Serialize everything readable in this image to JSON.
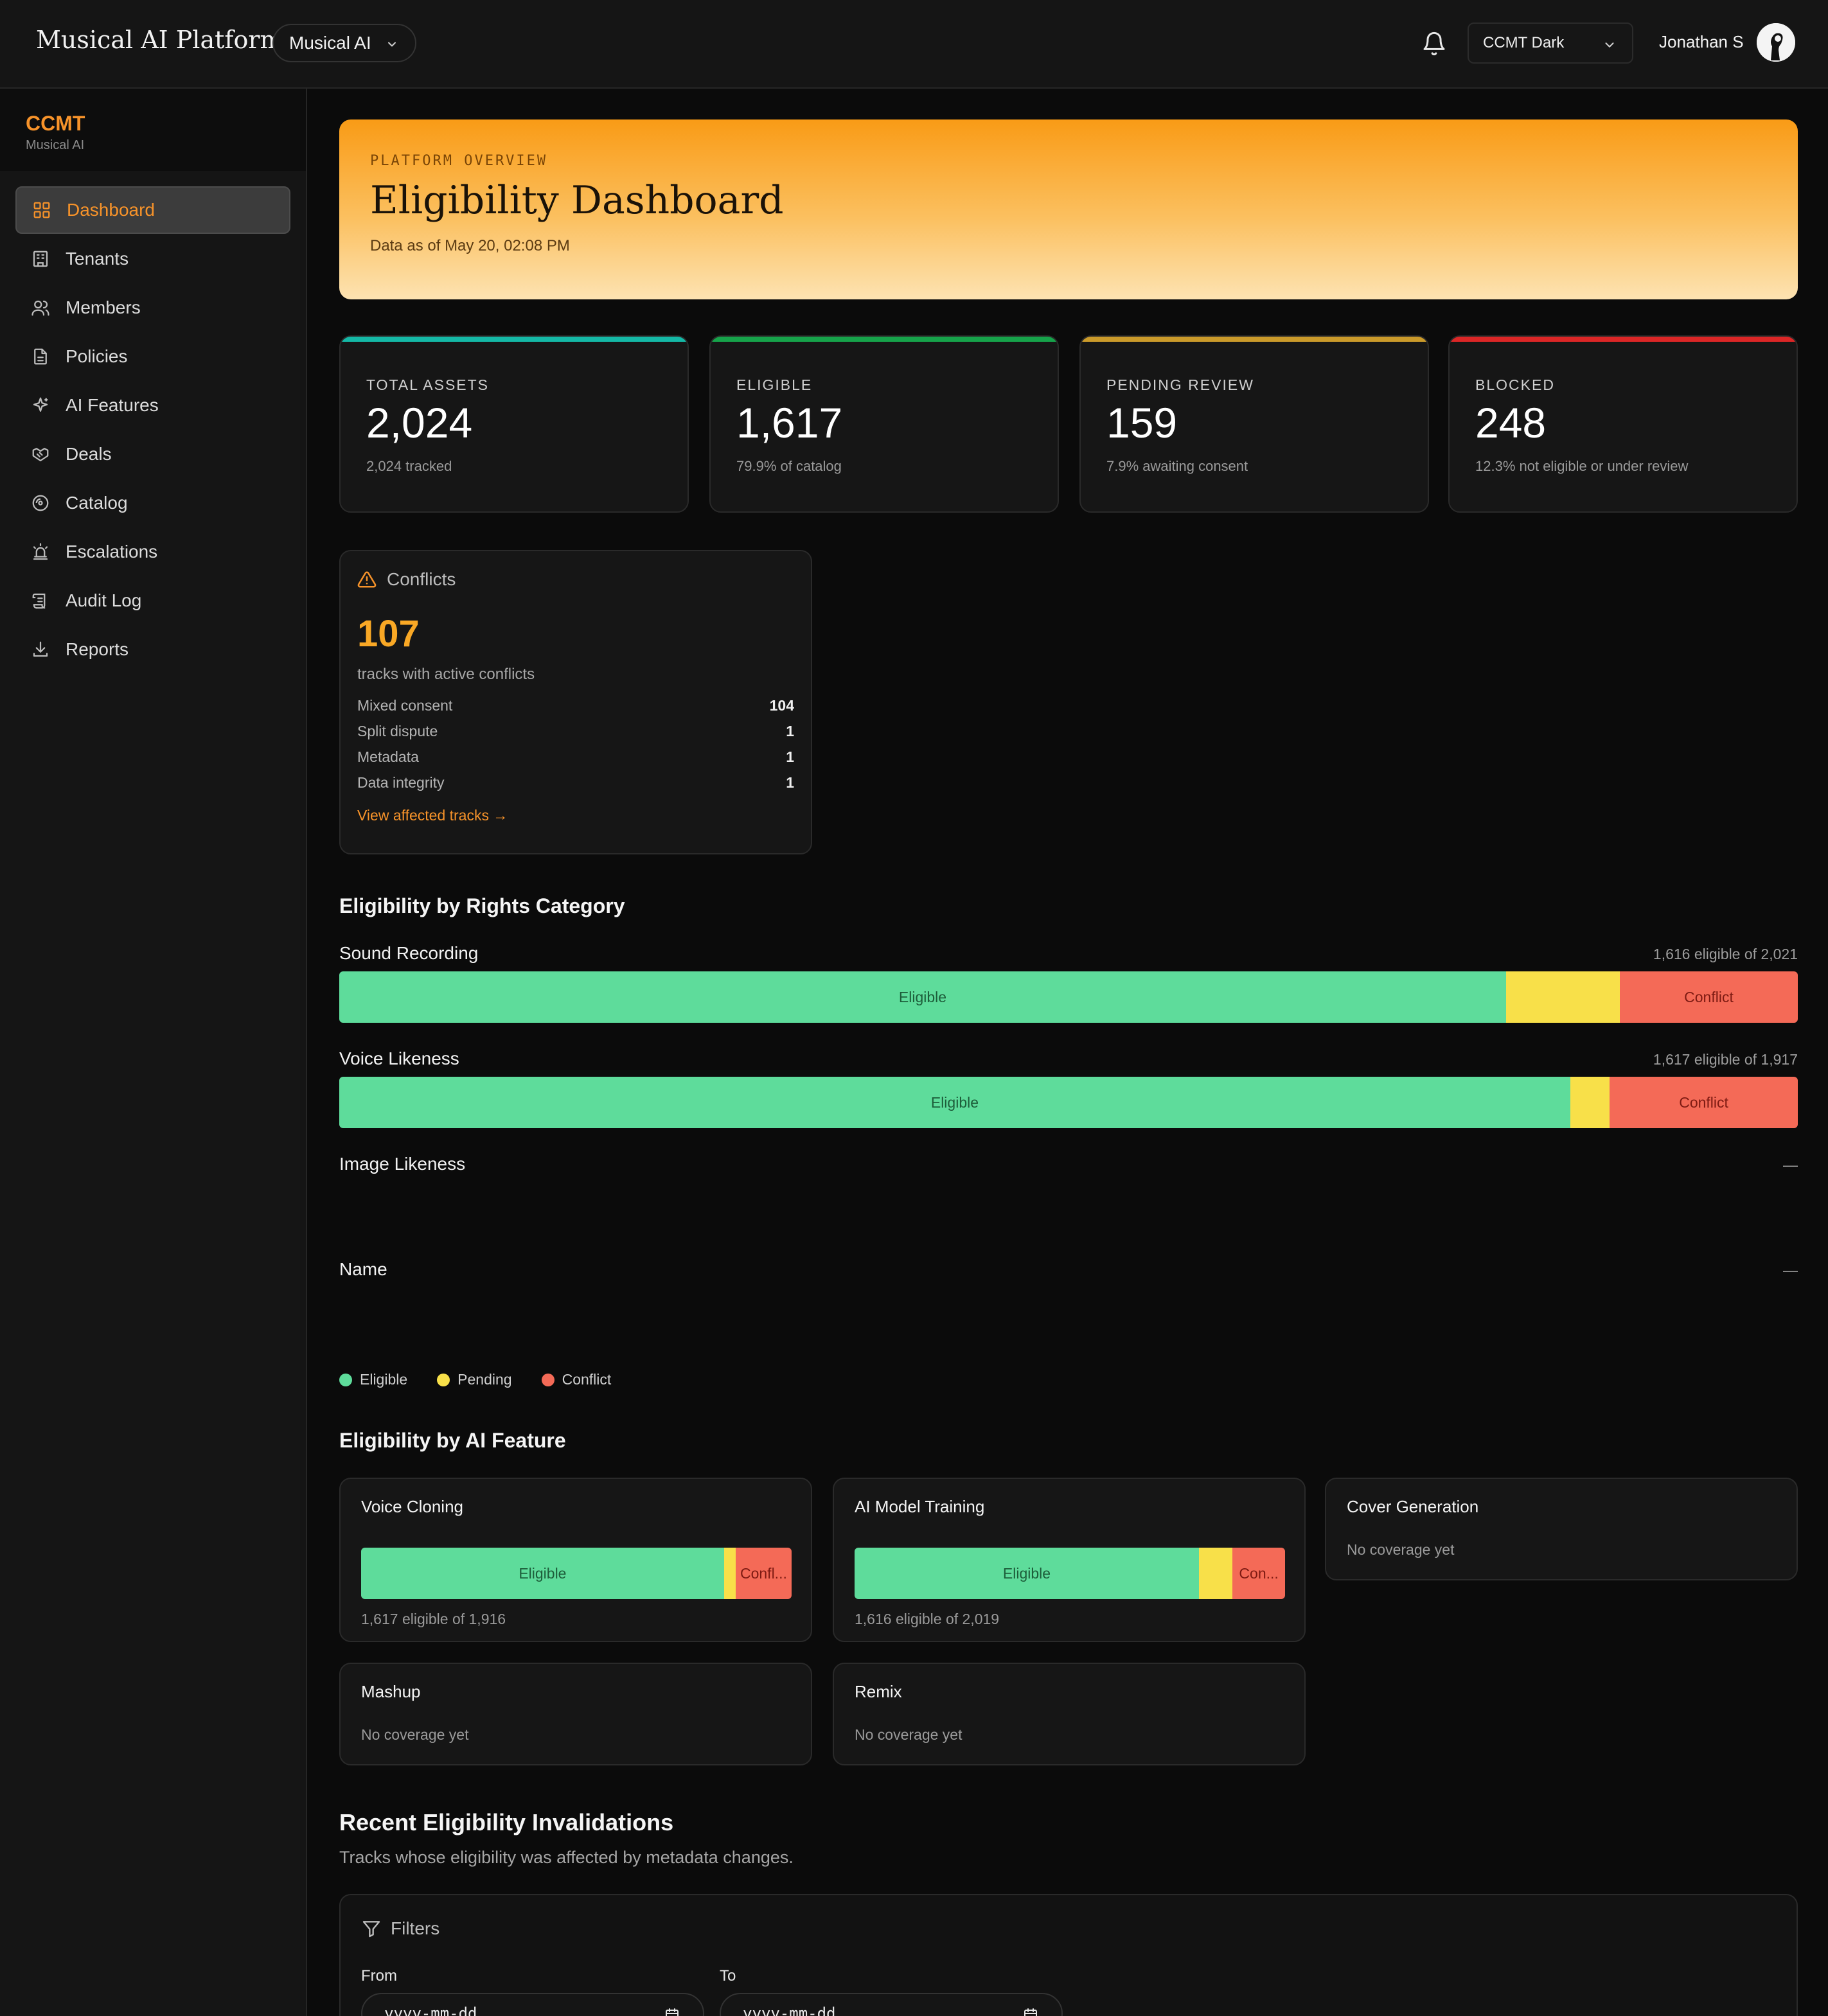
{
  "header": {
    "brand": "Musical AI Platform",
    "org_select": "Musical AI",
    "theme_select": "CCMT Dark",
    "user_name": "Jonathan S"
  },
  "sidebar": {
    "title": "CCMT",
    "subtitle": "Musical AI",
    "items": [
      {
        "label": "Dashboard",
        "icon": "grid-icon",
        "active": true
      },
      {
        "label": "Tenants",
        "icon": "building-icon"
      },
      {
        "label": "Members",
        "icon": "users-icon"
      },
      {
        "label": "Policies",
        "icon": "file-text-icon"
      },
      {
        "label": "AI Features",
        "icon": "sparkles-icon"
      },
      {
        "label": "Deals",
        "icon": "handshake-icon"
      },
      {
        "label": "Catalog",
        "icon": "disc-icon"
      },
      {
        "label": "Escalations",
        "icon": "siren-icon"
      },
      {
        "label": "Audit Log",
        "icon": "scroll-icon"
      },
      {
        "label": "Reports",
        "icon": "download-icon"
      }
    ]
  },
  "hero": {
    "eyebrow": "PLATFORM OVERVIEW",
    "title": "Eligibility Dashboard",
    "subtitle": "Data as of May 20, 02:08 PM"
  },
  "stats": [
    {
      "label": "TOTAL ASSETS",
      "value": "2,024",
      "sub": "2,024 tracked",
      "color": "#14b8a6"
    },
    {
      "label": "ELIGIBLE",
      "value": "1,617",
      "sub": "79.9% of catalog",
      "color": "#16a34a"
    },
    {
      "label": "PENDING REVIEW",
      "value": "159",
      "sub": "7.9% awaiting consent",
      "color": "#ca9a2a"
    },
    {
      "label": "BLOCKED",
      "value": "248",
      "sub": "12.3% not eligible or under review",
      "color": "#dc2626"
    }
  ],
  "conflicts": {
    "title": "Conflicts",
    "count": "107",
    "subtitle": "tracks with active conflicts",
    "rows": [
      {
        "label": "Mixed consent",
        "value": "104"
      },
      {
        "label": "Split dispute",
        "value": "1"
      },
      {
        "label": "Metadata",
        "value": "1"
      },
      {
        "label": "Data integrity",
        "value": "1"
      }
    ],
    "link": "View affected tracks →"
  },
  "rights": {
    "title": "Eligibility by Rights Category",
    "categories": [
      {
        "name": "Sound Recording",
        "count": "1,616 eligible of 2,021",
        "eligible": 0.8,
        "pending": 0.078,
        "conflict": 0.122,
        "eligible_label": "Eligible",
        "conflict_label": "Conflict"
      },
      {
        "name": "Voice Likeness",
        "count": "1,617 eligible of 1,917",
        "eligible": 0.844,
        "pending": 0.027,
        "conflict": 0.129,
        "eligible_label": "Eligible",
        "conflict_label": "Conflict"
      },
      {
        "name": "Image Likeness",
        "count": "—"
      },
      {
        "name": "Name",
        "count": "—"
      }
    ],
    "legend": [
      {
        "label": "Eligible",
        "color": "#5edc9b"
      },
      {
        "label": "Pending",
        "color": "#f8e049"
      },
      {
        "label": "Conflict",
        "color": "#f46a57"
      }
    ]
  },
  "features": {
    "title": "Eligibility by AI Feature",
    "items": [
      {
        "name": "Voice Cloning",
        "count": "1,617 eligible of 1,916",
        "eligible": 0.843,
        "pending": 0.027,
        "conflict": 0.13,
        "eligible_label": "Eligible",
        "conflict_label": "Confl..."
      },
      {
        "name": "AI Model Training",
        "count": "1,616 eligible of 2,019",
        "eligible": 0.8,
        "pending": 0.078,
        "conflict": 0.122,
        "eligible_label": "Eligible",
        "conflict_label": "Con..."
      },
      {
        "name": "Cover Generation",
        "empty": "No coverage yet"
      },
      {
        "name": "Mashup",
        "empty": "No coverage yet"
      },
      {
        "name": "Remix",
        "empty": "No coverage yet"
      }
    ]
  },
  "recent": {
    "title": "Recent Eligibility Invalidations",
    "subtitle": "Tracks whose eligibility was affected by metadata changes.",
    "filters_label": "Filters",
    "from_label": "From",
    "to_label": "To",
    "from_placeholder": "yyyy-mm-dd",
    "to_placeholder": "yyyy-mm-dd"
  }
}
